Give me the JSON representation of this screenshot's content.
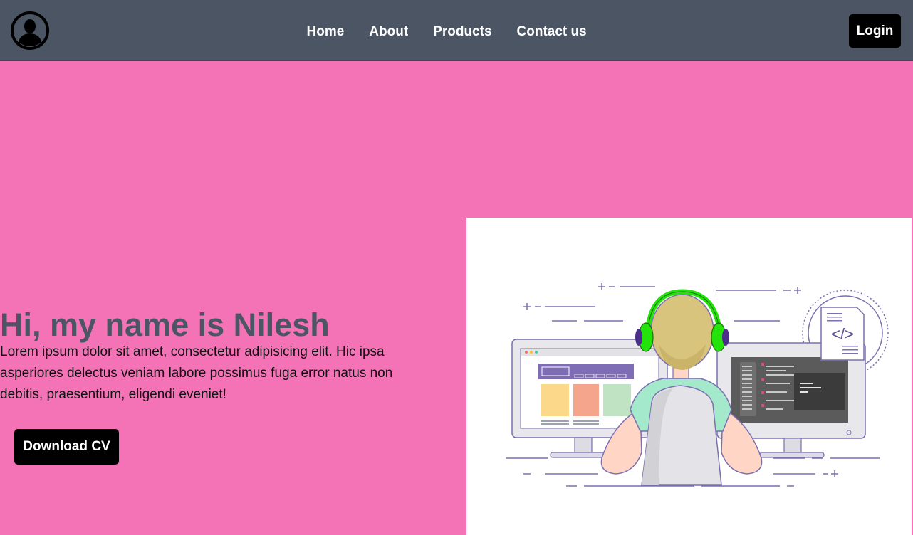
{
  "nav": {
    "links": [
      "Home",
      "About",
      "Products",
      "Contact us"
    ],
    "login_label": "Login"
  },
  "hero": {
    "title": "Hi, my name is Nilesh",
    "text": "Lorem ipsum dolor sit amet, consectetur adipisicing elit. Hic ipsa asperiores delectus veniam labore possimus fuga error natus non debitis, praesentium, eligendi eveniet!",
    "cv_label": "Download CV"
  },
  "illustration": {
    "code_symbol": "</>"
  },
  "colors": {
    "nav_bg": "#4b5563",
    "page_bg": "#f472b6",
    "button_bg": "#000000",
    "title": "#4b5563",
    "headphones": "#22e30a"
  }
}
